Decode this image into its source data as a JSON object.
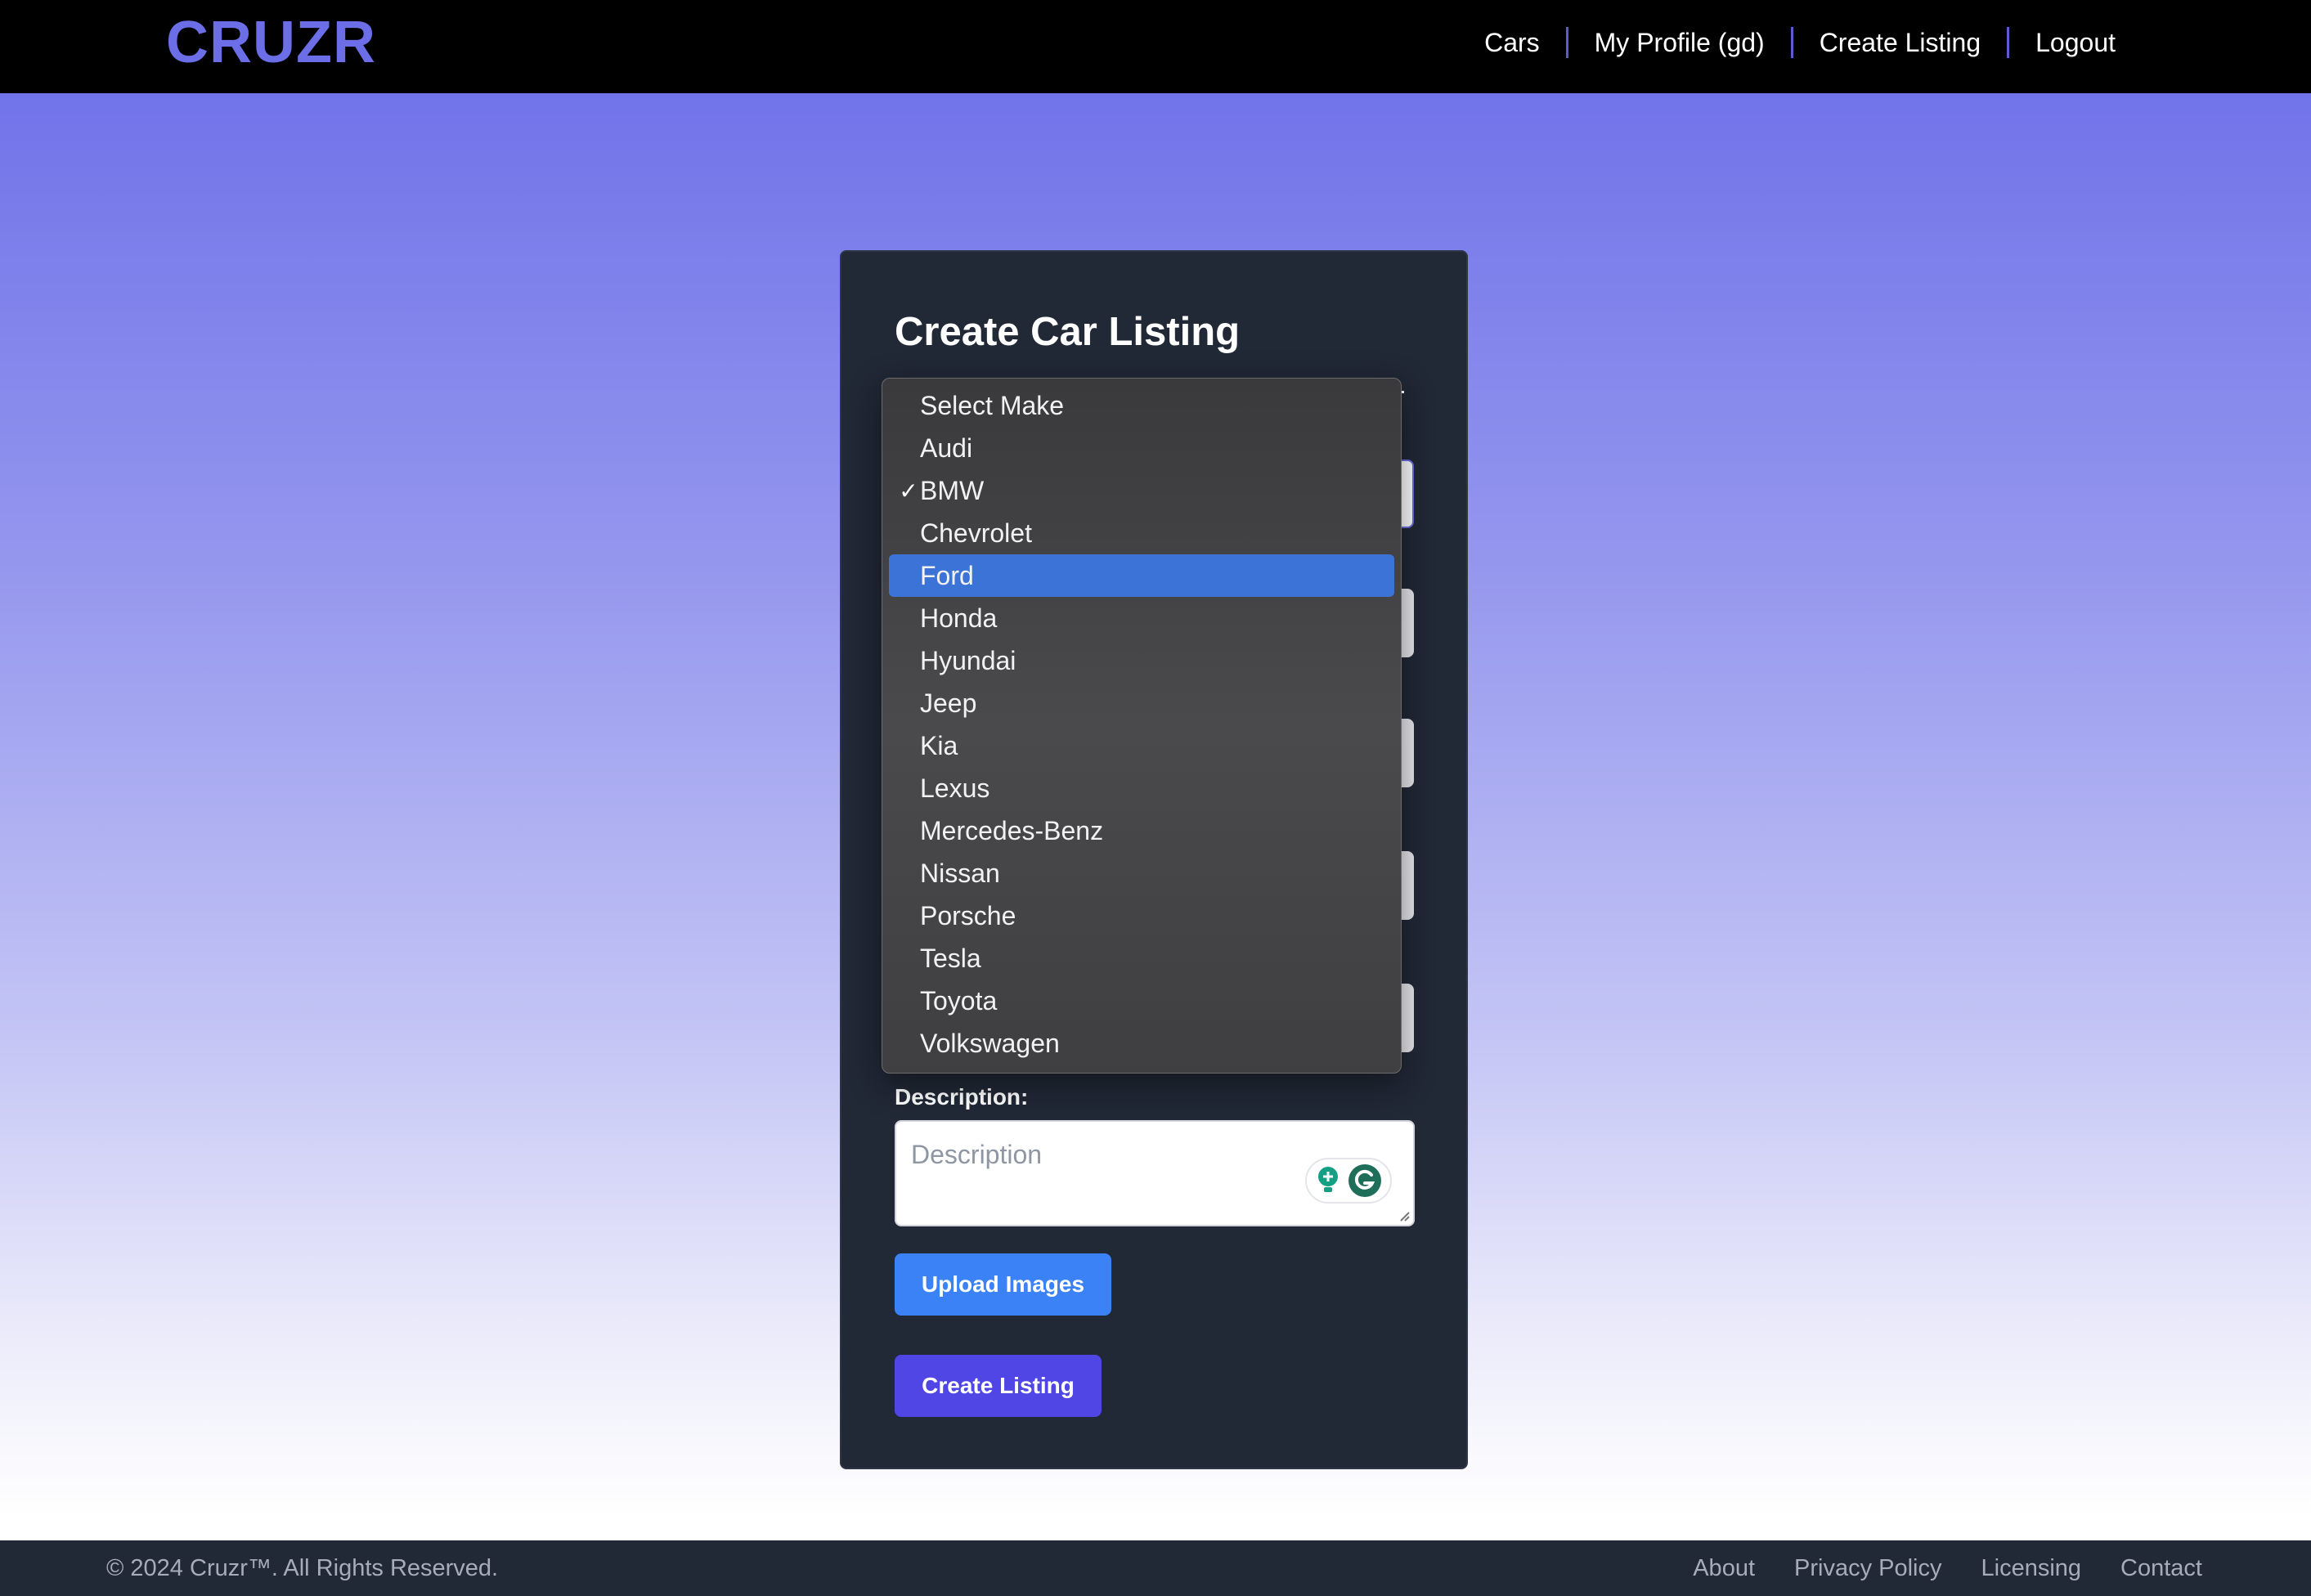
{
  "header": {
    "logo": "CRUZR",
    "nav": [
      "Cars",
      "My Profile (gd)",
      "Create Listing",
      "Logout"
    ]
  },
  "form": {
    "title": "Create Car Listing",
    "make_select": {
      "selected": "BMW",
      "highlighted": "Ford",
      "options": [
        "Select Make",
        "Audi",
        "BMW",
        "Chevrolet",
        "Ford",
        "Honda",
        "Hyundai",
        "Jeep",
        "Kia",
        "Lexus",
        "Mercedes-Benz",
        "Nissan",
        "Porsche",
        "Tesla",
        "Toyota",
        "Volkswagen"
      ]
    },
    "description_label": "Description:",
    "description_placeholder": "Description",
    "upload_label": "Upload Images",
    "submit_label": "Create Listing"
  },
  "footer": {
    "copyright": "© 2024 Cruzr™. All Rights Reserved.",
    "links": [
      "About",
      "Privacy Policy",
      "Licensing",
      "Contact"
    ]
  },
  "colors": {
    "brand": "#6b6ee6",
    "upload_button": "#3b82f6",
    "submit_button": "#4f46e5",
    "highlight": "#3b74d6"
  }
}
